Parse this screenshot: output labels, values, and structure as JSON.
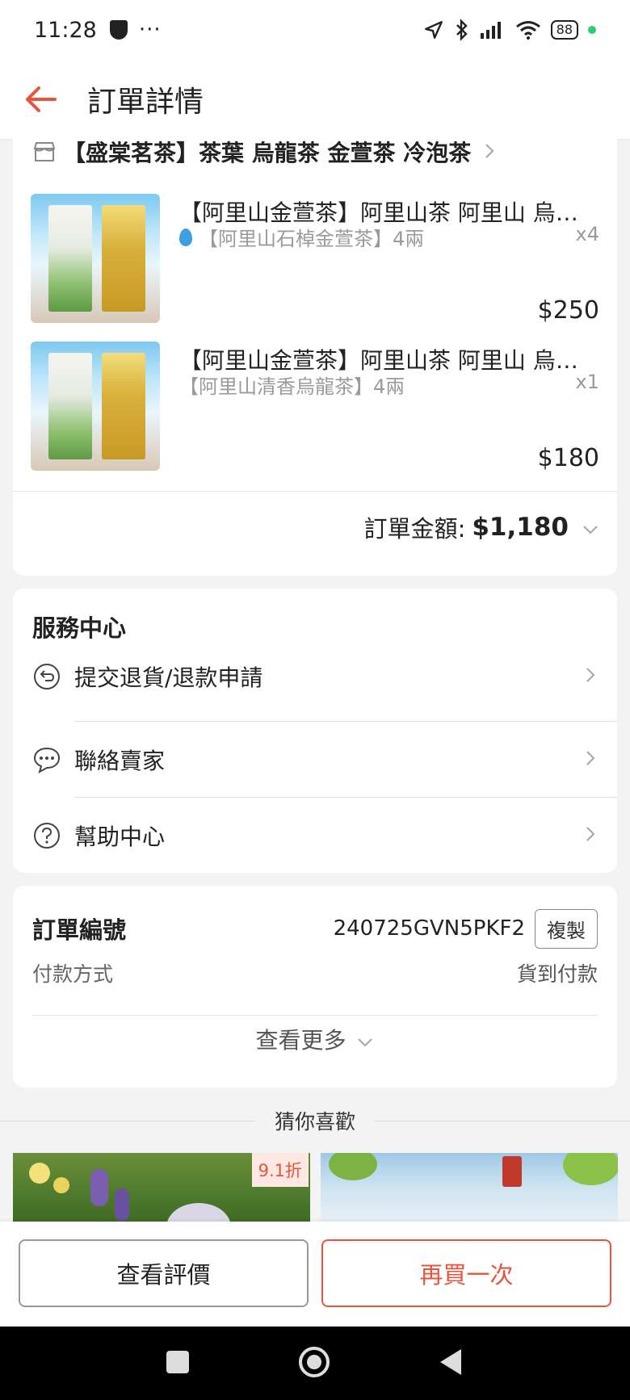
{
  "status_bar": {
    "time": "11:28",
    "dots": "···",
    "battery": "88"
  },
  "header": {
    "title": "訂單詳情"
  },
  "shop": {
    "name": "【盛棠茗茶】茶葉 烏龍茶 金萱茶 冷泡茶",
    "items": [
      {
        "name": "【阿里山金萱茶】阿里山茶 阿里山 烏龍茶 高山茶 茶葉",
        "variant": "【阿里山石棹金萱茶】4兩",
        "qty": "x4",
        "price": "$250"
      },
      {
        "name": "【阿里山金萱茶】阿里山茶 阿里山 烏龍茶 高山茶 茶葉",
        "variant": "【阿里山清香烏龍茶】4兩",
        "qty": "x1",
        "price": "$180"
      }
    ],
    "total_label": "訂單金額:",
    "total_amount": "$1,180"
  },
  "service": {
    "title": "服務中心",
    "rows": [
      {
        "label": "提交退貨/退款申請"
      },
      {
        "label": "聯絡賣家"
      },
      {
        "label": "幫助中心"
      }
    ]
  },
  "order_info": {
    "number_label": "訂單編號",
    "number": "240725GVN5PKF2",
    "copy_label": "複製",
    "payment_label": "付款方式",
    "payment_value": "貨到付款",
    "more_label": "查看更多"
  },
  "recommend": {
    "title": "猜你喜歡",
    "discount": "9.1折"
  },
  "actions": {
    "review": "查看評價",
    "rebuy": "再買一次"
  }
}
